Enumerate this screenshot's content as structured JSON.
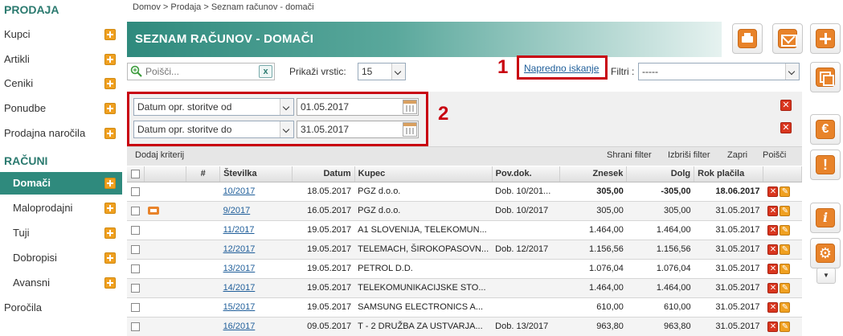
{
  "sidebar": {
    "heading_sales": "PRODAJA",
    "sales_items": [
      "Kupci",
      "Artikli",
      "Ceniki",
      "Ponudbe",
      "Prodajna naročila"
    ],
    "heading_invoices": "RAČUNI",
    "invoice_items": [
      "Domači",
      "Maloprodajni",
      "Tuji",
      "Dobropisi",
      "Avansni"
    ],
    "reports": "Poročila",
    "active_item": "Domači"
  },
  "breadcrumb": "Domov  >  Prodaja  >  Seznam računov - domači",
  "page_title": "SEZNAM RAČUNOV - DOMAČI",
  "search": {
    "placeholder": "Poišči...",
    "clear": "x"
  },
  "rows_label": "Prikaži vrstic:",
  "rows_value": "15",
  "advanced_search": "Napredno iskanje",
  "filter_label": "Filtri :",
  "filter_value": "-----",
  "markers": {
    "one": "1",
    "two": "2"
  },
  "criteria": [
    {
      "field": "Datum opr. storitve od",
      "value": "01.05.2017"
    },
    {
      "field": "Datum opr. storitve do",
      "value": "31.05.2017"
    }
  ],
  "toolbar": {
    "add_criterion": "Dodaj kriterij",
    "save_filter": "Shrani filter",
    "delete_filter": "Izbriši filter",
    "close": "Zapri",
    "search": "Poišči"
  },
  "table": {
    "headers": [
      "#",
      "Številka",
      "Datum",
      "Kupec",
      "Pov.dok.",
      "Znesek",
      "Dolg",
      "Rok plačila"
    ],
    "rows": [
      {
        "num": "10/2017",
        "date": "18.05.2017",
        "customer": "PGZ d.o.o.",
        "ref": "Dob. 10/201...",
        "amount": "305,00",
        "debt": "-305,00",
        "due": "18.06.2017",
        "green": true,
        "printed": false
      },
      {
        "num": "9/2017",
        "date": "16.05.2017",
        "customer": "PGZ d.o.o.",
        "ref": "Dob. 10/2017",
        "amount": "305,00",
        "debt": "305,00",
        "due": "31.05.2017",
        "green": false,
        "printed": true
      },
      {
        "num": "11/2017",
        "date": "19.05.2017",
        "customer": "A1 SLOVENIJA, TELEKOMUN...",
        "ref": "",
        "amount": "1.464,00",
        "debt": "1.464,00",
        "due": "31.05.2017",
        "green": false,
        "printed": false
      },
      {
        "num": "12/2017",
        "date": "19.05.2017",
        "customer": "TELEMACH, ŠIROKOPASOVN...",
        "ref": "Dob. 12/2017",
        "amount": "1.156,56",
        "debt": "1.156,56",
        "due": "31.05.2017",
        "green": false,
        "printed": false
      },
      {
        "num": "13/2017",
        "date": "19.05.2017",
        "customer": "PETROL D.D.",
        "ref": "",
        "amount": "1.076,04",
        "debt": "1.076,04",
        "due": "31.05.2017",
        "green": false,
        "printed": false
      },
      {
        "num": "14/2017",
        "date": "19.05.2017",
        "customer": "TELEKOMUNIKACIJSKE STO...",
        "ref": "",
        "amount": "1.464,00",
        "debt": "1.464,00",
        "due": "31.05.2017",
        "green": false,
        "printed": false
      },
      {
        "num": "15/2017",
        "date": "19.05.2017",
        "customer": "SAMSUNG ELECTRONICS A...",
        "ref": "",
        "amount": "610,00",
        "debt": "610,00",
        "due": "31.05.2017",
        "green": false,
        "printed": false
      },
      {
        "num": "16/2017",
        "date": "09.05.2017",
        "customer": "T - 2 DRUŽBA ZA USTVARJA...",
        "ref": "Dob. 13/2017",
        "amount": "963,80",
        "debt": "963,80",
        "due": "31.05.2017",
        "green": false,
        "printed": false
      }
    ]
  },
  "right_icons": {
    "euro": "€",
    "warning": "!",
    "info": "i",
    "gear": "⚙",
    "more": "▼"
  }
}
